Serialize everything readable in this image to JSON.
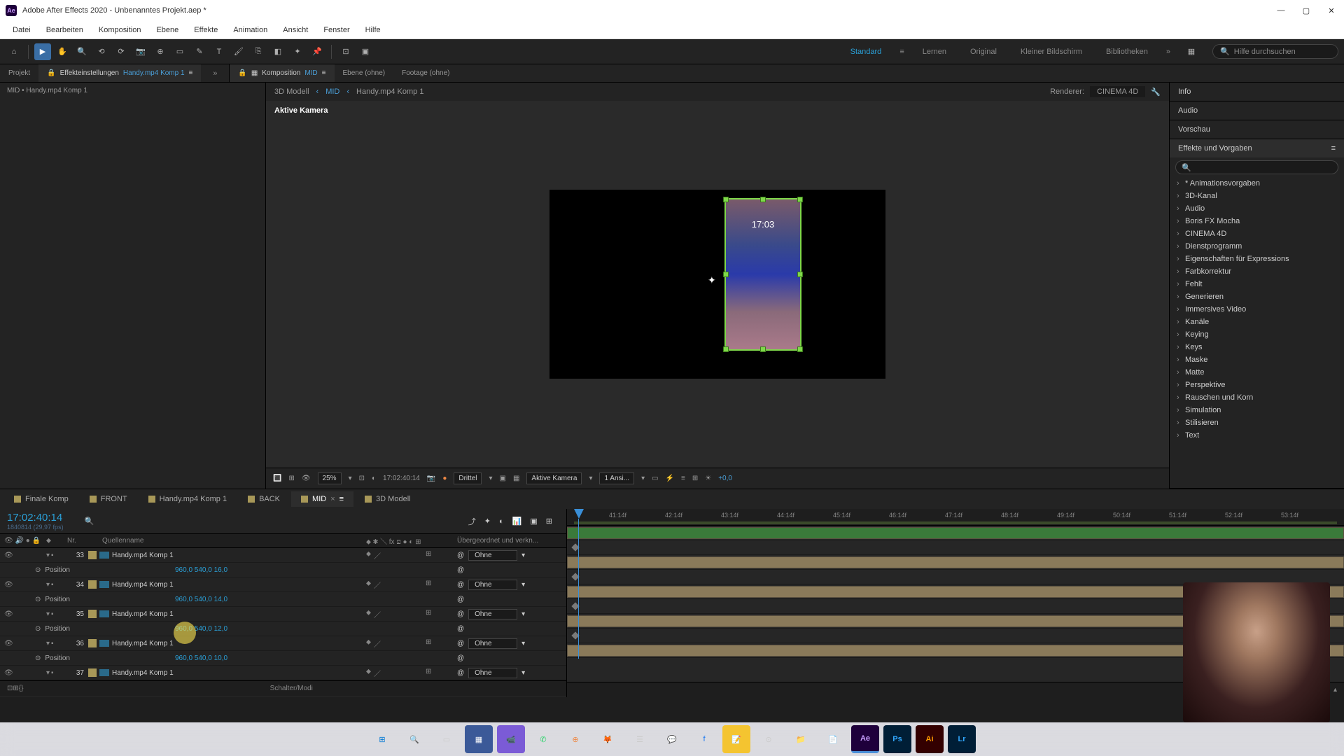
{
  "titlebar": {
    "app_name": "Adobe After Effects 2020 - Unbenanntes Projekt.aep *"
  },
  "menu": [
    "Datei",
    "Bearbeiten",
    "Komposition",
    "Ebene",
    "Effekte",
    "Animation",
    "Ansicht",
    "Fenster",
    "Hilfe"
  ],
  "workspace": {
    "items": [
      "Standard",
      "Lernen",
      "Original",
      "Kleiner Bildschirm",
      "Bibliotheken"
    ],
    "active": "Standard",
    "search_placeholder": "Hilfe durchsuchen"
  },
  "top_tabs": {
    "project": "Projekt",
    "effect_controls": "Effekteinstellungen",
    "effect_controls_item": "Handy.mp4 Komp 1",
    "composition": "Komposition",
    "composition_item": "MID",
    "layer": "Ebene (ohne)",
    "footage": "Footage (ohne)"
  },
  "breadcrumb": "MID • Handy.mp4 Komp 1",
  "viewer": {
    "bc_items": [
      "3D Modell",
      "MID",
      "Handy.mp4 Komp 1"
    ],
    "renderer_label": "Renderer:",
    "renderer_value": "CINEMA 4D",
    "camera_label": "Aktive Kamera",
    "phone_time": "17:03"
  },
  "viewer_footer": {
    "zoom": "25%",
    "time": "17:02:40:14",
    "resolution": "Drittel",
    "view": "Aktive Kamera",
    "views_count": "1 Ansi...",
    "exposure": "+0,0"
  },
  "right_panels": {
    "info": "Info",
    "audio": "Audio",
    "preview": "Vorschau",
    "effects": "Effekte und Vorgaben"
  },
  "effects_list": [
    "* Animationsvorgaben",
    "3D-Kanal",
    "Audio",
    "Boris FX Mocha",
    "CINEMA 4D",
    "Dienstprogramm",
    "Eigenschaften für Expressions",
    "Farbkorrektur",
    "Fehlt",
    "Generieren",
    "Immersives Video",
    "Kanäle",
    "Keying",
    "Keys",
    "Maske",
    "Matte",
    "Perspektive",
    "Rauschen und Korn",
    "Simulation",
    "Stilisieren",
    "Text"
  ],
  "comp_tabs": [
    {
      "name": "Finale Komp",
      "active": false
    },
    {
      "name": "FRONT",
      "active": false
    },
    {
      "name": "Handy.mp4 Komp 1",
      "active": false
    },
    {
      "name": "BACK",
      "active": false
    },
    {
      "name": "MID",
      "active": true
    },
    {
      "name": "3D Modell",
      "active": false
    }
  ],
  "timeline": {
    "timecode": "17:02:40:14",
    "timecode_sub": "1840814 (29,97 fps)",
    "col_nr": "Nr.",
    "col_source": "Quellenname",
    "col_parent": "Übergeordnet und verkn...",
    "footer_label": "Schalter/Modi",
    "ruler": [
      "41:14f",
      "42:14f",
      "43:14f",
      "44:14f",
      "45:14f",
      "46:14f",
      "47:14f",
      "48:14f",
      "49:14f",
      "50:14f",
      "51:14f",
      "52:14f",
      "53:14f"
    ]
  },
  "layers": [
    {
      "num": "33",
      "name": "Handy.mp4 Komp 1",
      "parent": "Ohne",
      "prop": "Position",
      "val": "960,0 540,0 16,0"
    },
    {
      "num": "34",
      "name": "Handy.mp4 Komp 1",
      "parent": "Ohne",
      "prop": "Position",
      "val": "960,0 540,0 14,0"
    },
    {
      "num": "35",
      "name": "Handy.mp4 Komp 1",
      "parent": "Ohne",
      "prop": "Position",
      "val": "960,0 540,0 12,0"
    },
    {
      "num": "36",
      "name": "Handy.mp4 Komp 1",
      "parent": "Ohne",
      "prop": "Position",
      "val": "960,0 540,0 10,0"
    },
    {
      "num": "37",
      "name": "Handy.mp4 Komp 1",
      "parent": "Ohne"
    }
  ]
}
